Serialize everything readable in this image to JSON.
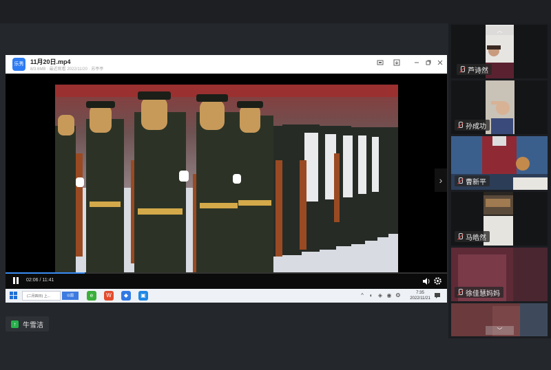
{
  "player": {
    "app_icon": "film-app-icon",
    "app_icon_label": "乐秀",
    "file_name": "11月20日.mp4",
    "file_meta": "8/3.6MB · 最近观看 2022/11/20 · 苏亭亭",
    "header_buttons": [
      "screenshot-icon",
      "download-icon",
      "minimize-icon",
      "restore-icon",
      "close-icon"
    ],
    "current_time": "02:06",
    "duration": "11:41",
    "time_display": "02:06 / 11:41",
    "progress_fraction": 0.18,
    "accent_color": "#3a8df5"
  },
  "taskbar": {
    "search_text": "(二月四日) 上...",
    "search_tag": "以图",
    "pinned_apps": [
      {
        "name": "360-browser-icon",
        "color": "#3aae3a",
        "glyph": "e"
      },
      {
        "name": "wps-icon",
        "color": "#e34b2f",
        "glyph": "W"
      },
      {
        "name": "feishu-icon",
        "color": "#3179e4",
        "glyph": "◆"
      },
      {
        "name": "meeting-icon",
        "color": "#1e88e5",
        "glyph": "▣"
      }
    ],
    "clock_time": "7:35",
    "clock_date": "2022/11/21"
  },
  "presenter": {
    "name": "牛雪洁",
    "icon": "screen-share-icon"
  },
  "participants": [
    {
      "name": "芦诗然",
      "muted": true
    },
    {
      "name": "孙成功",
      "muted": true
    },
    {
      "name": "曹新平",
      "muted": true
    },
    {
      "name": "马皓然",
      "muted": true
    },
    {
      "name": "徐佳慧妈妈",
      "muted": true
    }
  ],
  "participant_scroll": {
    "up_icon": "chevron-up-icon",
    "up_glyph": "︿",
    "down_icon": "chevron-down-icon",
    "down_glyph": "﹀"
  }
}
